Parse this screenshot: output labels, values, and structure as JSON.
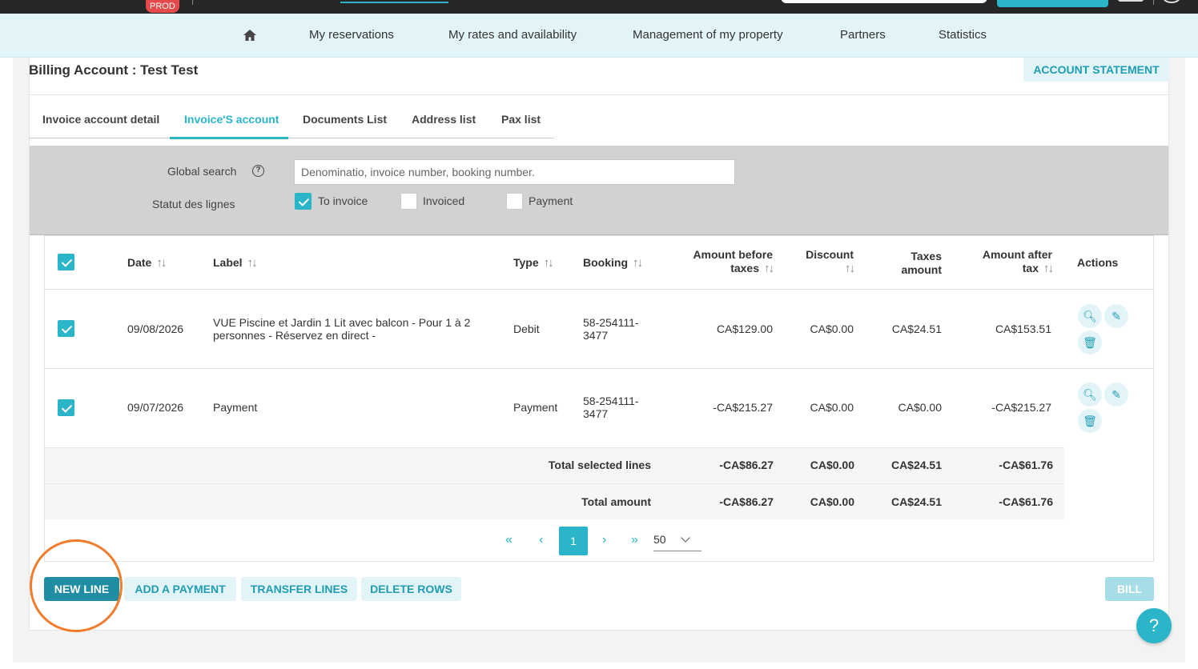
{
  "topbar": {
    "env_badge": "PROD"
  },
  "nav": {
    "items": [
      {
        "label": "My reservations"
      },
      {
        "label": "My rates and availability"
      },
      {
        "label": "Management of my property"
      },
      {
        "label": "Partners"
      },
      {
        "label": "Statistics"
      }
    ]
  },
  "page": {
    "title": "Billing Account : Test Test",
    "account_statement_label": "ACCOUNT STATEMENT"
  },
  "tabs": [
    {
      "label": "Invoice account detail"
    },
    {
      "label": "Invoice'S account",
      "active": true
    },
    {
      "label": "Documents List"
    },
    {
      "label": "Address list"
    },
    {
      "label": "Pax list"
    }
  ],
  "filter": {
    "global_search_label": "Global search",
    "search_placeholder": "Denominatio, invoice number, booking number.",
    "status_label": "Statut des lignes",
    "statuses": [
      {
        "label": "To invoice",
        "checked": true
      },
      {
        "label": "Invoiced",
        "checked": false
      },
      {
        "label": "Payment",
        "checked": false
      }
    ]
  },
  "table": {
    "headers": {
      "date": "Date",
      "label": "Label",
      "type": "Type",
      "booking": "Booking",
      "amount_before_l1": "Amount before",
      "amount_before_l2": "taxes",
      "discount": "Discount",
      "taxes_l1": "Taxes",
      "taxes_l2": "amount",
      "amount_after_l1": "Amount after",
      "amount_after_l2": "tax",
      "actions": "Actions"
    },
    "rows": [
      {
        "date": "09/08/2026",
        "label_l1": "VUE Piscine et Jardin 1 Lit avec balcon - Pour 1 à 2",
        "label_l2": "personnes - Réservez en direct -",
        "type": "Debit",
        "booking_l1": "58-254111-",
        "booking_l2": "3477",
        "amount_before": "CA$129.00",
        "discount": "CA$0.00",
        "taxes": "CA$24.51",
        "amount_after": "CA$153.51"
      },
      {
        "date": "09/07/2026",
        "label_l1": "Payment",
        "label_l2": "",
        "type": "Payment",
        "booking_l1": "58-254111-",
        "booking_l2": "3477",
        "amount_before": "-CA$215.27",
        "discount": "CA$0.00",
        "taxes": "CA$0.00",
        "amount_after": "-CA$215.27"
      }
    ],
    "totals": [
      {
        "label": "Total selected lines",
        "amount_before": "-CA$86.27",
        "discount": "CA$0.00",
        "taxes": "CA$24.51",
        "amount_after": "-CA$61.76"
      },
      {
        "label": "Total amount",
        "amount_before": "-CA$86.27",
        "discount": "CA$0.00",
        "taxes": "CA$24.51",
        "amount_after": "-CA$61.76"
      }
    ]
  },
  "pagination": {
    "first": "«",
    "prev": "‹",
    "current": "1",
    "next": "›",
    "last": "»",
    "page_size": "50"
  },
  "buttons": {
    "new_line": "NEW LINE",
    "add_payment": "ADD A PAYMENT",
    "transfer_lines": "TRANSFER LINES",
    "delete_rows": "DELETE ROWS",
    "bill": "BILL"
  },
  "help_fab": "?",
  "colors": {
    "accent": "#2bb5c9",
    "accent_dark": "#1f8da3",
    "highlight": "#f07c2c",
    "nav_bg": "#e3f4f8"
  }
}
